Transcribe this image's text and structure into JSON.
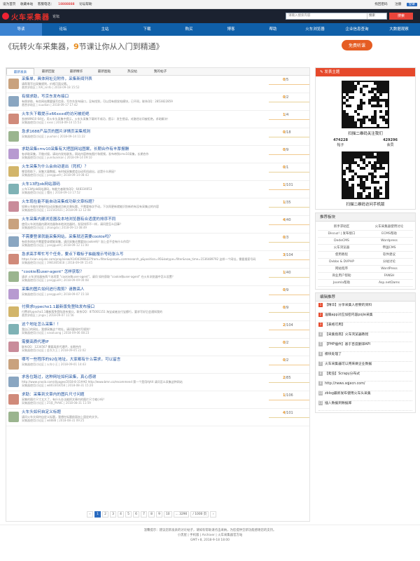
{
  "topbar": {
    "items": [
      "设为首页",
      "收藏本站",
      "客服电话：",
      "18888888",
      "论坛帮助"
    ],
    "right": [
      "找回密码",
      "注册",
      "登录"
    ]
  },
  "header": {
    "logo": "火车采集器",
    "sub": "论坛",
    "search_placeholder": "请输入搜索内容",
    "search_type": "搜索",
    "search_btn": "搜索"
  },
  "nav": [
    "导读",
    "论坛",
    "主站",
    "下载",
    "购买",
    "博客",
    "帮助",
    "火车浏览器",
    "企业信息查询",
    "大数据观察"
  ],
  "banner": {
    "text_a": "《玩转火车采集器，",
    "num": "9",
    "text_b": "节课让你从入门到精通》",
    "btn": "免费听课"
  },
  "tabs": [
    "最新发表",
    "最新回复",
    "最新精华",
    "最新图贴",
    "热议帖",
    "我的帖子"
  ],
  "threads": [
    {
      "title": "采集单，具体网址见附件，采集新闻列表",
      "desc": "请帮我写出采集规则，价格可面议哦。",
      "meta": "悬赏求助区 | XAI_ninfo | 2018-09-18 15:52",
      "cnt": "0",
      "views": "/5"
    },
    {
      "title": "有偿求助，写京东发布接口",
      "desc": "有偿求助，有些网站需要填写信息，写京东发布接口，没有找到，可以用有偿发帖模块，已不同，联系QQ：2853822859",
      "meta": "悬赏求助区 | vuudian | 2018-09-17 17:42",
      "cnt": "0",
      "views": "/2"
    },
    {
      "title": "火车头下载提示x66xxxd的访问被拒绝",
      "desc": "系统WIN10 64位，用火车头采集中提示，火车头采集下载时不成功，提示：发生错误，对路径访问被拒绝。求助解决！",
      "meta": "采集器使用讨论区 | vxxs | 2018-09-14 15:53",
      "cnt": "1",
      "views": "/4"
    },
    {
      "title": "急求1688产品页的图片详情页采集规则",
      "desc": "",
      "meta": "采集器使用讨论区 | yuuhan | 2018-09-14 11:22",
      "cnt": "0",
      "views": "/18"
    },
    {
      "title": "求助采集cmv10采集有大把国网站图案，长期合作有丰厚报酬",
      "desc": "有求助采集，不做对接，请站内发帖联系，网站内容带有图片和视频，发布带到cmv10采集，长期合作",
      "meta": "采集器使用讨论区 | yunduankan | 2018-09-14 09:10",
      "cnt": "0",
      "views": "/9"
    },
    {
      "title": "火车采集为什么会自动退出（死机）？",
      "desc": "哪里帮助下，采集大量数据，有时候采集就会自动死机退出，这是什么原因？",
      "meta": "采集器使用讨论区 | yangguo9 | 2018-09-14 08:43",
      "cnt": "0",
      "views": "/1"
    },
    {
      "title": "火车13的job网站源码",
      "desc": "火车13的job网站源码，有能力者联系QQ：648334053",
      "meta": "采集器使用讨论区 | 懂社 | 2018-09-13 17:52",
      "cnt": "1",
      "views": "/101"
    },
    {
      "title": "火车现在能不能自动采集成功新文章标题？",
      "desc": "如果火车能在更新时自动采集成功新文章标题，不需要每次手动，下次再更新就能识别新的有没有采集过的内容",
      "meta": "采集器使用讨论区 | 331561921 | 2018-09-13 12:08",
      "cnt": "1",
      "views": "/35"
    },
    {
      "title": "火车采集内建浏览器及本地浏览器有合适度的排序不同",
      "desc": "使用火车浏览器内建浏览器和本地浏览器时，发现排序不一样，请问是怎么回事？",
      "meta": "采集器使用讨论区 | zhangda | 2018-09-13 08:49",
      "cnt": "4",
      "views": "/40"
    },
    {
      "title": "不需要登录就能采集网站，采集就还需要cookie吗？",
      "desc": "有很多网站不需要登录就能采集，请问采集还需要加cookie吗？加上会不会有什么作用？",
      "meta": "采集器使用讨论区 | yangguo9 | 2018-09-12 11:00",
      "cnt": "0",
      "views": "/3"
    },
    {
      "title": "急求高手帮忙写个任务，要点下载标子抽能搜示号码张么写",
      "desc": "https://xian.anjuke.com/prop/view/A1404396622?from=filter&spread=commsearch_p&position=95&kwtype=filter&now_time=1536489792 这样一个网址，需要搜索号码",
      "meta": "采集器使用讨论区 | 1981805818 | 2018-09-09 15:45",
      "cnt": "3",
      "views": "/104"
    },
    {
      "title": "\"cookie和user-agent\" 怎样获取？",
      "desc": "请求 火车浏览器有两个选项是 \"cookie和user-agent\"，请问 如何获取 \"cookie和user-agent\" 在火车浏览器中怎么设置？",
      "meta": "采集器使用讨论区 | yangguo9 | 2018-09-09 00:08",
      "cnt": "1",
      "views": "/40"
    },
    {
      "title": "采集的图片如何进行裁剪？请教高人",
      "desc": "",
      "meta": "采集器使用讨论区 | yangguo9 | 2018-09-07 15:18",
      "cnt": "0",
      "views": "/9"
    },
    {
      "title": "付费求typecho1.1最新版免登陆发布接口",
      "desc": "付费求typecho1.1最新版免登陆发布接口，联系QQ：875001151 淘宝或者支付宝都行，要求写好后会通知我的",
      "meta": "悬赏求助区 | jingix | 2018-09-07 11:56",
      "cnt": "0",
      "views": "/9"
    },
    {
      "title": "这个地址怎么采集！！",
      "desc": "我自己的网址，我想采集这个地址，请问要如何写规则？",
      "meta": "采集器使用讨论区 | vasoluong | 2018-09-06 08:23",
      "cnt": "2",
      "views": "/104"
    },
    {
      "title": "需要高质代理IP",
      "desc": "联系QQ：1234567 需要高质代理IP，长期合作",
      "meta": "采集器使用讨论区 | 金东大王 | 2018-09-05 22:02",
      "cnt": "0",
      "views": "/2"
    },
    {
      "title": "哪写一些程序的92在地址，大家都有什么需求，可以留言",
      "desc": "",
      "meta": "采集器使用讨论区 | 火车小王 | 2018-09-01 14:43",
      "cnt": "0",
      "views": "/2"
    },
    {
      "title": "求各位路过，这种网址如何采集，真心感谢",
      "desc": "http://www.ynocb.com/d/pages/2018-8-31#AO http://www.bmn.co/recommend 第一个是用AJAX 请问怎么采集这种网站",
      "meta": "采集器使用讨论区 | w803303058 | 2018-08-31 15:20",
      "cnt": "2",
      "views": "/85"
    },
    {
      "title": "求助：采集到文章内的图片尺寸问题",
      "desc": "采集的图片尺寸太大了，有什么办法能把文章内的图片尺寸缩小吗？",
      "meta": "采集器使用讨论区 | 25家_PtAKC | 2018-08-31 11:59",
      "cnt": "1",
      "views": "/106"
    },
    {
      "title": "火车头如何自定义标题",
      "desc": "请问火车头如何自定义标题，我想在标题前面加上固定的文字。",
      "meta": "采集器使用讨论区 | w8888 | 2018-08-31 09:25",
      "cnt": "4",
      "views": "/101"
    }
  ],
  "pager": {
    "prev": "‹",
    "pages": [
      "1",
      "2",
      "3",
      "4",
      "5",
      "6",
      "7",
      "8",
      "9",
      "10"
    ],
    "dots": "... 3290",
    "next": "›",
    "goto": "/ 1000 页"
  },
  "sidebar": {
    "publish": "发表主题",
    "qr_caption": "扫描二维码关注我们",
    "stats": [
      {
        "num": "474228",
        "label": "帖子"
      },
      {
        "num": "429296",
        "label": "会员"
      }
    ],
    "qr2_caption": "扫描二维码访问手机版",
    "tags_title": "推荐板块",
    "tags": [
      "新手求助区",
      "火车采集器使用讨论",
      "Discuz! | 发布接口",
      "ECMS帮助",
      "DedeCMS",
      "Wordpress",
      "火车浏览器",
      "帝国CMS",
      "使用教程",
      "软件建议",
      "Dvbbs & DVPHP",
      "分站讨论",
      "网站程序",
      "WordPress",
      "商业用户帮助",
      "FANSH",
      "Joomla帮助",
      "Asp.netDams"
    ],
    "rec_title": "编辑推荐",
    "rec": [
      "【精华】分享采集人想要的资料",
      "准确app对应加密内容pojie采集",
      "【表格可用】",
      "【采集指南】火车浏览器教程",
      "【PHP插件】基于百度翻译API",
      "模块处理了",
      "火车采集器可以用来做企业数据",
      "【爬虫】Scrapy分布式",
      "http://news.sqjecn.com/",
      "zblog最新发布使用火车头采集",
      "插入数据到数据库"
    ]
  },
  "footer": {
    "line1": "温馨提示：建议您新发表的讨论帖子，请如有帮助请点击采纳，为您提供全新功能感谢您的支持。",
    "line2": "小黑屋  |  手机版  |  Archiver  |  火车采集器官方站",
    "line3": "GMT+8, 2018-9-18 18:00"
  }
}
